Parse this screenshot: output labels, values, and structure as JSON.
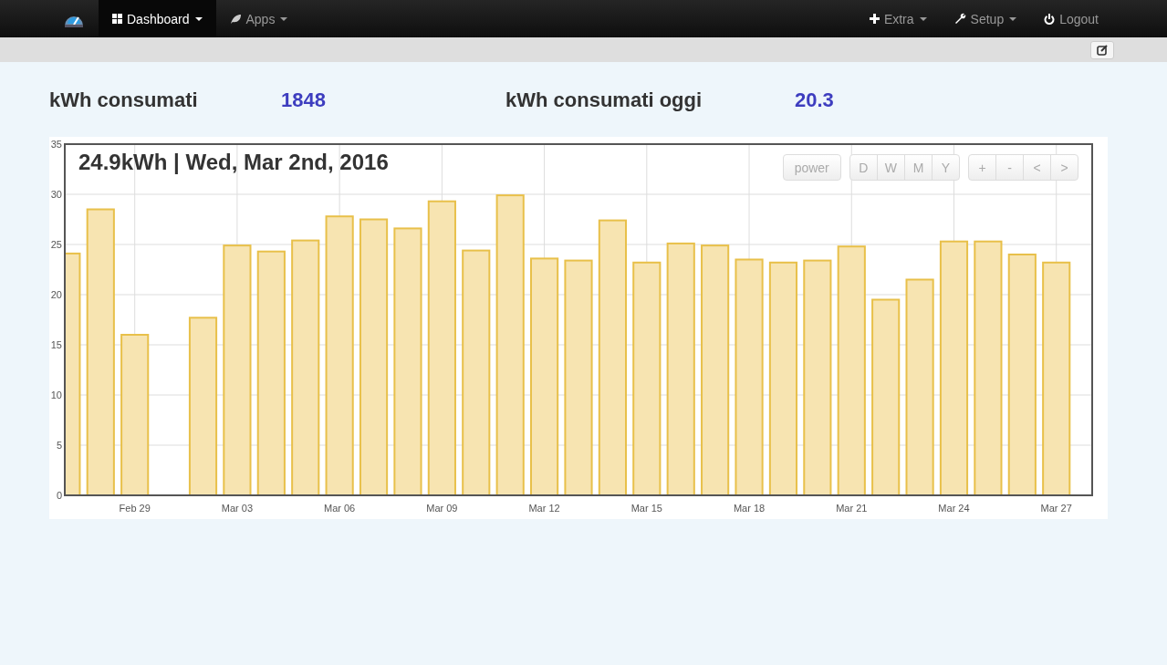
{
  "navbar": {
    "left_items": [
      {
        "label": "Dashboard",
        "selected": true,
        "dropdown": true
      },
      {
        "label": "Apps",
        "selected": false,
        "dropdown": true
      }
    ],
    "right_items": [
      {
        "label": "Extra",
        "dropdown": true
      },
      {
        "label": "Setup",
        "dropdown": true
      },
      {
        "label": "Logout",
        "dropdown": false
      }
    ]
  },
  "stats": [
    {
      "label": "kWh consumati",
      "value": "1848"
    },
    {
      "label": "kWh consumati oggi",
      "value": "20.3"
    }
  ],
  "chart": {
    "title": "24.9kWh | Wed, Mar 2nd, 2016",
    "button_groups": [
      [
        "power"
      ],
      [
        "D",
        "W",
        "M",
        "Y"
      ],
      [
        "+",
        "-",
        "<",
        ">"
      ]
    ],
    "chart_data": {
      "type": "bar",
      "categories": [
        null,
        null,
        "Feb 29",
        null,
        null,
        "Mar 03",
        null,
        null,
        "Mar 06",
        null,
        null,
        "Mar 09",
        null,
        null,
        "Mar 12",
        null,
        null,
        "Mar 15",
        null,
        null,
        "Mar 18",
        null,
        null,
        "Mar 21",
        null,
        null,
        "Mar 24",
        null,
        null,
        "Mar 27"
      ],
      "series": [
        {
          "color": "#e8c04a",
          "values": [
            24.1,
            28.5,
            16.0,
            null,
            17.7,
            24.9,
            24.3,
            25.4,
            27.8,
            27.5,
            26.6,
            29.3,
            24.4,
            29.9,
            23.6,
            23.4,
            27.4,
            23.2,
            25.1,
            24.9,
            23.5,
            23.2,
            23.4,
            24.8,
            19.5,
            21.5,
            25.3,
            25.3,
            24.0,
            23.2
          ]
        }
      ],
      "ylim": [
        0,
        35
      ],
      "grid": true,
      "yticks": [
        0,
        5,
        10,
        15,
        20,
        25,
        30,
        35
      ]
    }
  }
}
